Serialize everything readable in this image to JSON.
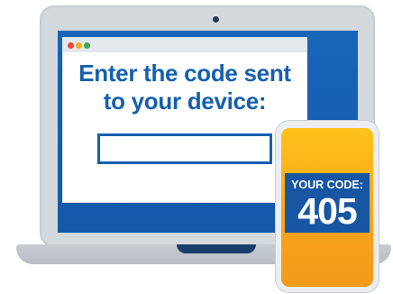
{
  "laptop": {
    "prompt_line1": "Enter the code sent",
    "prompt_line2": "to your device:",
    "code_input_value": ""
  },
  "phone": {
    "code_label": "YOUR CODE:",
    "code_value": "405"
  },
  "colors": {
    "brand_blue": "#1560ae",
    "screen_blue": "#1457a6",
    "phone_orange": "#f8a51a",
    "laptop_gray": "#d4d9de"
  }
}
